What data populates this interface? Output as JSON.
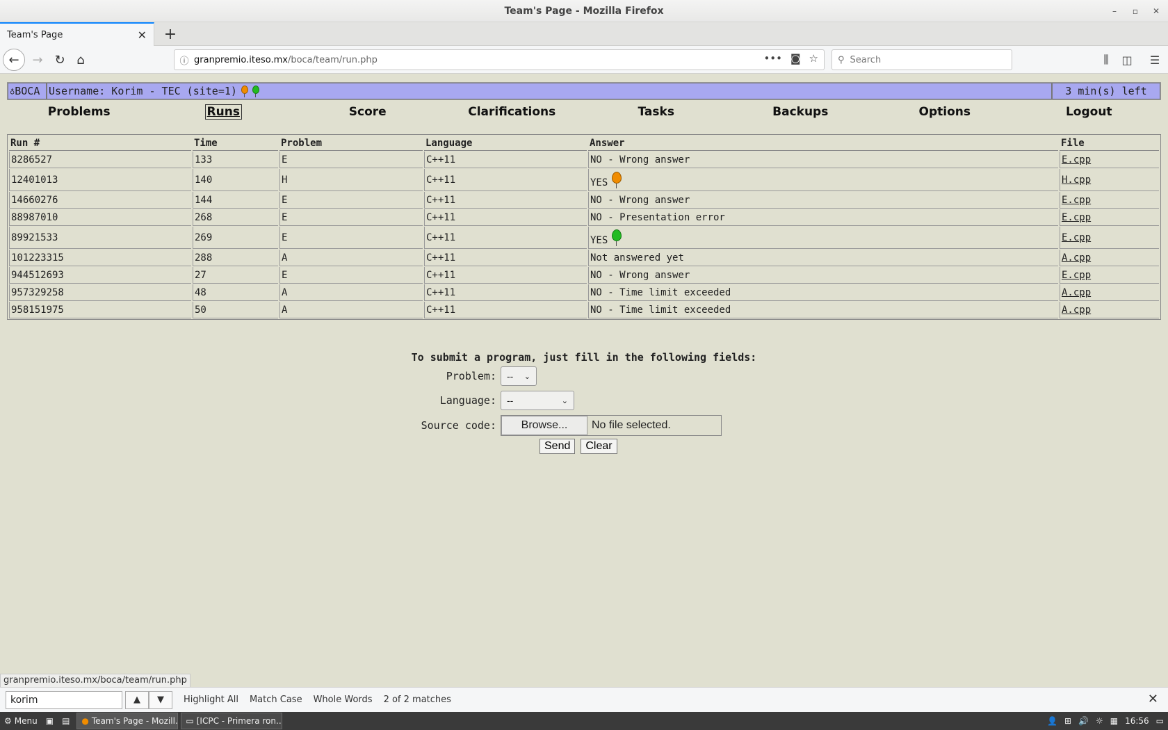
{
  "window": {
    "title": "Team's Page - Mozilla Firefox",
    "controls": [
      "–",
      "▫",
      "✕"
    ]
  },
  "tabs": [
    {
      "label": "Team's Page"
    }
  ],
  "navbar": {
    "url_host": "granpremio.iteso.mx",
    "url_path": "/boca/team/run.php",
    "search_placeholder": "Search"
  },
  "boca": {
    "logo_text": "BOCA",
    "username_text": "Username: Korim - TEC (site=1)",
    "time_left": "3 min(s) left",
    "header_balloons": [
      "#f08c00",
      "#22bb22"
    ]
  },
  "menu": {
    "items": [
      {
        "label": "Problems",
        "active": false
      },
      {
        "label": "Runs",
        "active": true
      },
      {
        "label": "Score",
        "active": false
      },
      {
        "label": "Clarifications",
        "active": false
      },
      {
        "label": "Tasks",
        "active": false
      },
      {
        "label": "Backups",
        "active": false
      },
      {
        "label": "Options",
        "active": false
      },
      {
        "label": "Logout",
        "active": false
      }
    ]
  },
  "runs": {
    "headers": [
      "Run #",
      "Time",
      "Problem",
      "Language",
      "Answer",
      "File"
    ],
    "rows": [
      {
        "run": "8286527",
        "time": "133",
        "problem": "E",
        "language": "C++11",
        "answer": "NO - Wrong answer",
        "file": "E.cpp",
        "balloon": ""
      },
      {
        "run": "12401013",
        "time": "140",
        "problem": "H",
        "language": "C++11",
        "answer": "YES",
        "file": "H.cpp",
        "balloon": "#f08c00"
      },
      {
        "run": "14660276",
        "time": "144",
        "problem": "E",
        "language": "C++11",
        "answer": "NO - Wrong answer",
        "file": "E.cpp",
        "balloon": ""
      },
      {
        "run": "88987010",
        "time": "268",
        "problem": "E",
        "language": "C++11",
        "answer": "NO - Presentation error",
        "file": "E.cpp",
        "balloon": ""
      },
      {
        "run": "89921533",
        "time": "269",
        "problem": "E",
        "language": "C++11",
        "answer": "YES",
        "file": "E.cpp",
        "balloon": "#22bb22"
      },
      {
        "run": "101223315",
        "time": "288",
        "problem": "A",
        "language": "C++11",
        "answer": "Not answered yet",
        "file": "A.cpp",
        "balloon": ""
      },
      {
        "run": "944512693",
        "time": "27",
        "problem": "E",
        "language": "C++11",
        "answer": "NO - Wrong answer",
        "file": "E.cpp",
        "balloon": ""
      },
      {
        "run": "957329258",
        "time": "48",
        "problem": "A",
        "language": "C++11",
        "answer": "NO - Time limit exceeded",
        "file": "A.cpp",
        "balloon": ""
      },
      {
        "run": "958151975",
        "time": "50",
        "problem": "A",
        "language": "C++11",
        "answer": "NO - Time limit exceeded",
        "file": "A.cpp",
        "balloon": ""
      }
    ]
  },
  "submit": {
    "heading": "To submit a program, just fill in the following fields:",
    "problem_label": "Problem:",
    "problem_value": "--",
    "language_label": "Language:",
    "language_value": "--",
    "source_label": "Source code:",
    "browse_label": "Browse...",
    "file_status": "No file selected.",
    "send_label": "Send",
    "clear_label": "Clear"
  },
  "status_link": "granpremio.iteso.mx/boca/team/run.php",
  "findbar": {
    "query": "korim",
    "highlight_all": "Highlight All",
    "match_case": "Match Case",
    "whole_words": "Whole Words",
    "matches": "2 of 2 matches"
  },
  "taskbar": {
    "menu_label": "Menu",
    "windows": [
      "Team's Page - Mozill...",
      "[ICPC - Primera ron..."
    ],
    "clock": "16:56"
  }
}
